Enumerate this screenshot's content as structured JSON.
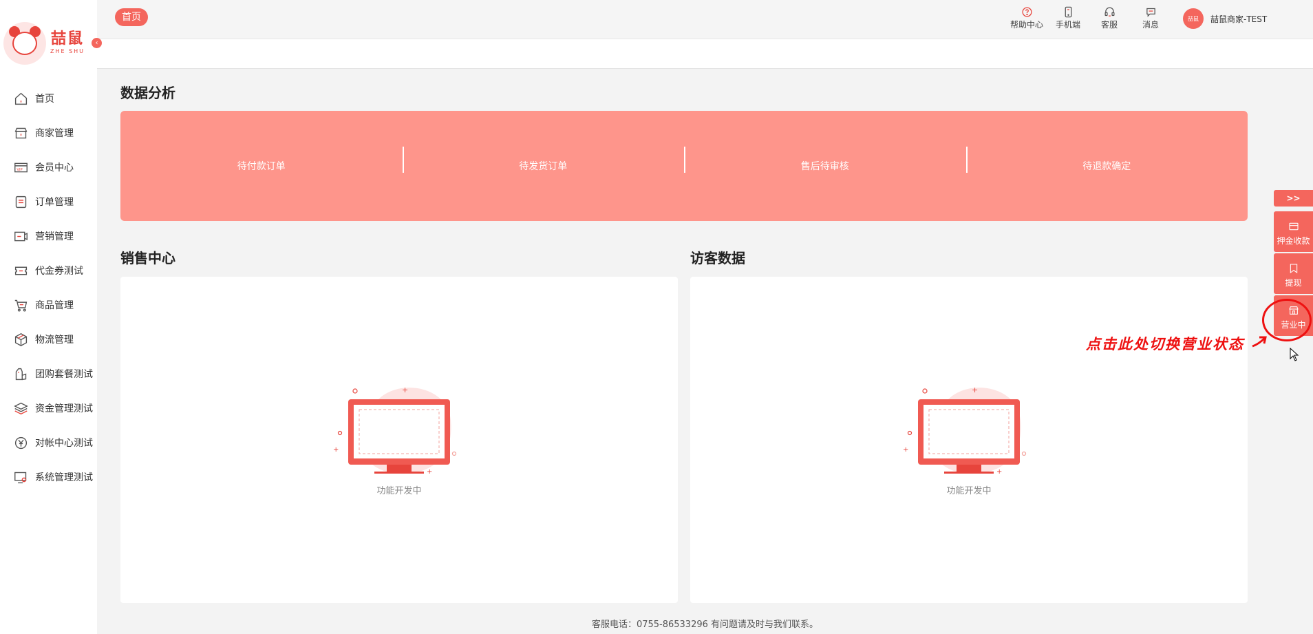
{
  "sidebar": {
    "logo_cn": "喆鼠",
    "logo_en": "ZHE SHU",
    "collapse_glyph": "‹",
    "items": [
      {
        "label": "首页",
        "icon": "home-icon"
      },
      {
        "label": "商家管理",
        "icon": "shop-icon"
      },
      {
        "label": "会员中心",
        "icon": "vip-card-icon"
      },
      {
        "label": "订单管理",
        "icon": "order-list-icon"
      },
      {
        "label": "营销管理",
        "icon": "marketing-icon"
      },
      {
        "label": "代金券测试",
        "icon": "coupon-icon"
      },
      {
        "label": "商品管理",
        "icon": "cart-icon"
      },
      {
        "label": "物流管理",
        "icon": "box-icon"
      },
      {
        "label": "团购套餐测试",
        "icon": "bag-icon"
      },
      {
        "label": "资金管理测试",
        "icon": "layers-icon"
      },
      {
        "label": "对帐中心测试",
        "icon": "yen-circle-icon"
      },
      {
        "label": "系统管理测试",
        "icon": "monitor-settings-icon"
      }
    ]
  },
  "header": {
    "home_tab": "首页",
    "tools": [
      {
        "label": "帮助中心",
        "icon": "help-icon"
      },
      {
        "label": "手机端",
        "icon": "mobile-icon"
      },
      {
        "label": "客服",
        "icon": "headset-icon"
      },
      {
        "label": "消息",
        "icon": "message-icon"
      }
    ],
    "avatar_text": "喆鼠",
    "user_name": "喆鼠商家-TEST"
  },
  "main": {
    "data_title": "数据分析",
    "data_items": [
      "待付款订单",
      "待发货订单",
      "售后待审核",
      "待退款确定"
    ],
    "sales_title": "销售中心",
    "visitor_title": "访客数据",
    "empty_text": "功能开发中"
  },
  "footer": {
    "text": "客服电话：0755-86533296 有问题请及时与我们联系。"
  },
  "right_bar": {
    "toggle": ">>",
    "items": [
      {
        "label": "押金收款",
        "icon": "deposit-icon"
      },
      {
        "label": "提现",
        "icon": "withdraw-icon"
      },
      {
        "label": "营业中",
        "icon": "store-icon"
      }
    ]
  },
  "annotation": {
    "text": "点击此处切换营业状态"
  },
  "colors": {
    "accent": "#f4665d",
    "banner": "#fe958b",
    "annotation": "#e11111"
  }
}
